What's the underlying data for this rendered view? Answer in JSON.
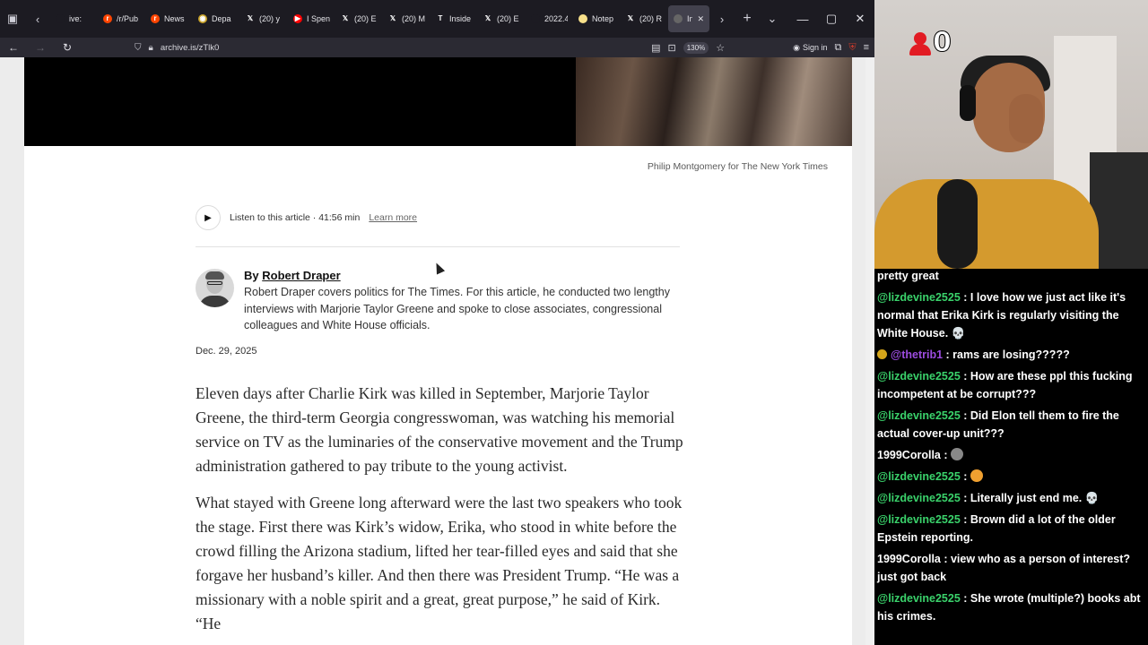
{
  "browser": {
    "tabs": [
      {
        "label": "ive:",
        "fav_color": "#1c1b22",
        "fav_glyph": ""
      },
      {
        "label": "/r/Pub",
        "fav_color": "#ff4500",
        "fav_glyph": "r"
      },
      {
        "label": "News",
        "fav_color": "#ff4500",
        "fav_glyph": "r"
      },
      {
        "label": "Depa",
        "fav_color": "#c9a227",
        "fav_glyph": "◉"
      },
      {
        "label": "(20) y",
        "fav_color": "#1c1b22",
        "fav_glyph": "𝕏"
      },
      {
        "label": "I Spen",
        "fav_color": "#ff0000",
        "fav_glyph": "▶"
      },
      {
        "label": "(20) E",
        "fav_color": "#1c1b22",
        "fav_glyph": "𝕏"
      },
      {
        "label": "(20) M",
        "fav_color": "#1c1b22",
        "fav_glyph": "𝕏"
      },
      {
        "label": "Inside",
        "fav_color": "#1c1b22",
        "fav_glyph": "T"
      },
      {
        "label": "(20) E",
        "fav_color": "#1c1b22",
        "fav_glyph": "𝕏"
      },
      {
        "label": "2022.4",
        "fav_color": "#1c1b22",
        "fav_glyph": ""
      },
      {
        "label": "Notep",
        "fav_color": "#f7e08a",
        "fav_glyph": ""
      },
      {
        "label": "(20) R",
        "fav_color": "#1c1b22",
        "fav_glyph": "𝕏"
      }
    ],
    "active_tab": {
      "label": "Ins"
    },
    "url": "archive.is/zTlk0",
    "zoom": "130%",
    "sign_in": "Sign in"
  },
  "article": {
    "photo_credit": "Philip Montgomery for The New York Times",
    "listen_text": "Listen to this article · 41:56 min",
    "learn_more": "Learn more",
    "by_prefix": "By",
    "author": "Robert Draper",
    "author_bio": "Robert Draper covers politics for The Times. For this article, he conducted two lengthy interviews with Marjorie Taylor Greene and spoke to close associates, congressional colleagues and White House officials.",
    "date": "Dec. 29, 2025",
    "paragraph_1": "Eleven days after Charlie Kirk was killed in September, Marjorie Taylor Greene, the third-term Georgia congresswoman, was watching his memorial service on TV as the luminaries of the conservative movement and the Trump administration gathered to pay tribute to the young activist.",
    "paragraph_2": "What stayed with Greene long afterward were the last two speakers who took the stage. First there was Kirk’s widow, Erika, who stood in white before the crowd filling the Arizona stadium, lifted her tear-filled eyes and said that she forgave her husband’s killer. And then there was President Trump. “He was a missionary with a noble spirit and a great, great purpose,” he said of Kirk. “He"
  },
  "stream": {
    "badge_count": "0",
    "chat": [
      {
        "user": "",
        "text": "pretty great",
        "color": "green"
      },
      {
        "user": "@lizdevine2525",
        "text": " : I love how we just act like it's normal that Erika Kirk is regularly visiting the White House. 💀",
        "color": "green"
      },
      {
        "user": "@thetrib1",
        "text": " : rams are losing?????",
        "color": "purple",
        "sub": true
      },
      {
        "user": "@lizdevine2525",
        "text": " : How are these ppl this fucking incompetent at be corrupt???",
        "color": "green"
      },
      {
        "user": "@lizdevine2525",
        "text": " : Did Elon tell them to fire the actual cover-up unit???",
        "color": "green"
      },
      {
        "user": "1999Corolla",
        "text": " : ",
        "color": "white",
        "emote": "#888"
      },
      {
        "user": "@lizdevine2525",
        "text": " : ",
        "color": "green",
        "emote": "#f0a030"
      },
      {
        "user": "@lizdevine2525",
        "text": " : Literally just end me. 💀",
        "color": "green"
      },
      {
        "user": "@lizdevine2525",
        "text": " : Brown did a lot of the older Epstein reporting.",
        "color": "green"
      },
      {
        "user": "1999Corolla",
        "text": " : view who as a person of interest? just got back",
        "color": "white"
      },
      {
        "user": "@lizdevine2525",
        "text": " : She wrote (multiple?) books abt his crimes.",
        "color": "green"
      }
    ]
  }
}
